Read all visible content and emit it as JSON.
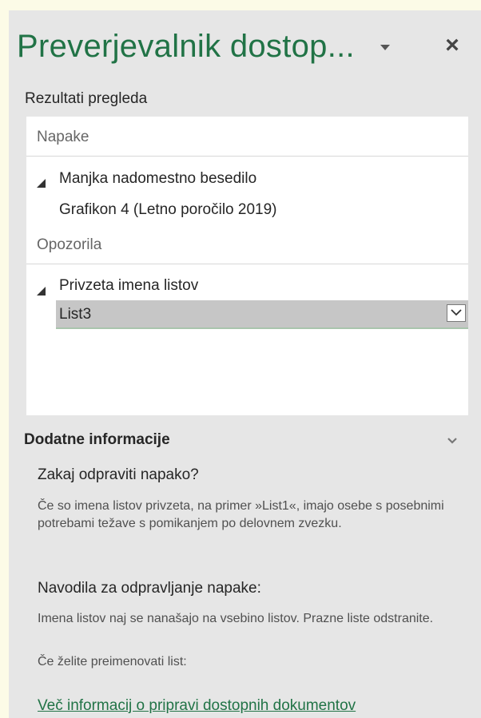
{
  "pane": {
    "title": "Preverjevalnik dostop...",
    "dropdown_icon": "triangle-down",
    "close_label": "×"
  },
  "results": {
    "label": "Rezultati pregleda",
    "groups": [
      {
        "heading": "Napake",
        "category": "Manjka nadomestno besedilo",
        "item": "Grafikon 4 (Letno poročilo  2019)"
      },
      {
        "heading": "Opozorila",
        "category": "Privzeta imena listov",
        "item": "List3"
      }
    ]
  },
  "info": {
    "title": "Dodatne informacije",
    "why_heading": "Zakaj odpraviti napako?",
    "why_text": "Če so imena listov privzeta, na primer »List1«, imajo osebe s posebnimi potrebami težave s pomikanjem po delovnem zvezku.",
    "how_heading": "Navodila za odpravljanje napake:",
    "how_text_1": "Imena listov naj se nanašajo na vsebino listov. Prazne liste odstranite.",
    "how_text_2": "Če želite preimenovati list:",
    "link": "Več informacij o pripravi dostopnih dokumentov"
  },
  "colors": {
    "accent": "#217346",
    "pane_bg": "#e6e6e6",
    "selection": "#c6c6c6"
  }
}
